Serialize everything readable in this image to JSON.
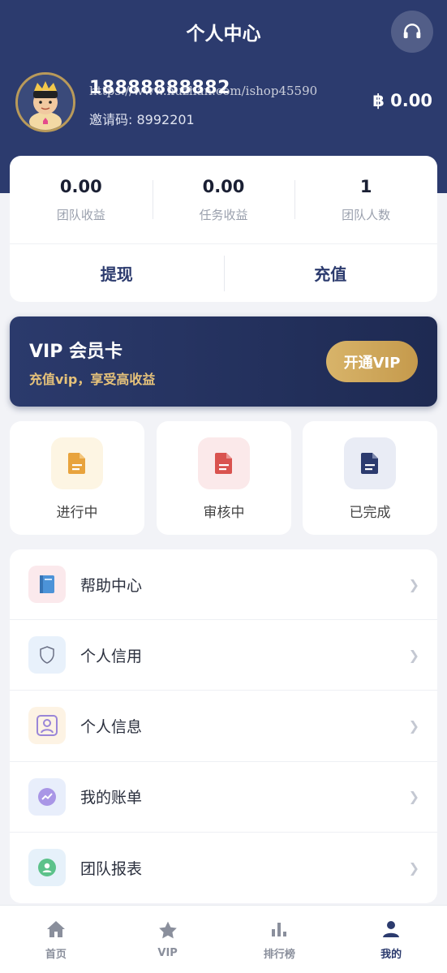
{
  "header": {
    "title": "个人中心",
    "support_icon": "headset-icon"
  },
  "profile": {
    "username": "18888888882",
    "invite_label": "邀请码: 8992201",
    "balance": "฿ 0.00",
    "watermark": "https://www.huzhan.com/ishop45590"
  },
  "stats": [
    {
      "value": "0.00",
      "label": "团队收益"
    },
    {
      "value": "0.00",
      "label": "任务收益"
    },
    {
      "value": "1",
      "label": "团队人数"
    }
  ],
  "actions": {
    "withdraw": "提现",
    "recharge": "充值"
  },
  "vip": {
    "title": "VIP 会员卡",
    "subtitle": "充值vip，享受高收益",
    "button": "开通VIP"
  },
  "tasks": [
    {
      "label": "进行中",
      "icon": "file-icon",
      "color": "#e8a33d",
      "bg": "#fdf5e3"
    },
    {
      "label": "审核中",
      "icon": "file-icon",
      "color": "#d9534f",
      "bg": "#fbe9ea"
    },
    {
      "label": "已完成",
      "icon": "file-icon",
      "color": "#2c3b6e",
      "bg": "#e9ecf5"
    }
  ],
  "menu": [
    {
      "label": "帮助中心",
      "icon": "book-icon"
    },
    {
      "label": "个人信用",
      "icon": "shield-icon"
    },
    {
      "label": "个人信息",
      "icon": "profile-card-icon"
    },
    {
      "label": "我的账单",
      "icon": "trend-chart-icon"
    },
    {
      "label": "团队报表",
      "icon": "team-icon"
    }
  ],
  "tabs": [
    {
      "label": "首页",
      "icon": "home-icon",
      "active": false
    },
    {
      "label": "VIP",
      "icon": "star-icon",
      "active": false
    },
    {
      "label": "排行榜",
      "icon": "bar-chart-icon",
      "active": false
    },
    {
      "label": "我的",
      "icon": "user-icon",
      "active": true
    }
  ],
  "colors": {
    "primary": "#2c3b6e",
    "gold": "#d8b46a"
  }
}
